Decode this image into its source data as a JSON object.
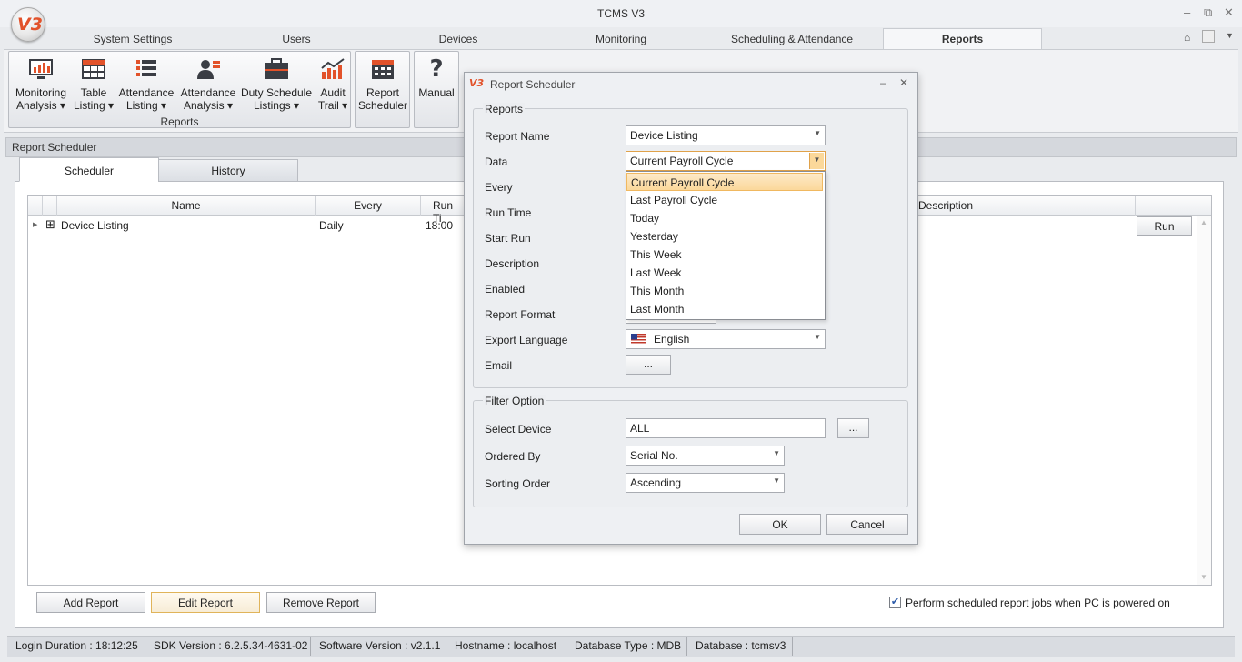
{
  "app": {
    "title": "TCMS V3",
    "logo": "V3"
  },
  "window_controls": [
    "minimize-icon",
    "restore-icon",
    "close-icon"
  ],
  "tabs": [
    {
      "label": "System Settings"
    },
    {
      "label": "Users"
    },
    {
      "label": "Devices"
    },
    {
      "label": "Monitoring"
    },
    {
      "label": "Scheduling & Attendance"
    },
    {
      "label": "Reports",
      "active": true
    }
  ],
  "ribbon": {
    "group_label": "Reports",
    "buttons": [
      {
        "line1": "Monitoring",
        "line2": "Analysis ▾",
        "icon": "monitor-chart-icon"
      },
      {
        "line1": "Table",
        "line2": "Listing ▾",
        "icon": "table-icon"
      },
      {
        "line1": "Attendance",
        "line2": "Listing ▾",
        "icon": "list-icon"
      },
      {
        "line1": "Attendance",
        "line2": "Analysis ▾",
        "icon": "user-chart-icon"
      },
      {
        "line1": "Duty Schedule",
        "line2": "Listings ▾",
        "icon": "briefcase-icon"
      },
      {
        "line1": "Audit",
        "line2": "Trail ▾",
        "icon": "audit-trail-icon"
      },
      {
        "line1": "Report",
        "line2": "Scheduler",
        "icon": "calendar-icon"
      },
      {
        "line1": "Manual",
        "line2": "",
        "icon": "question-icon"
      }
    ]
  },
  "panel": {
    "title": "Report Scheduler",
    "subtabs": [
      {
        "label": "Scheduler",
        "active": true
      },
      {
        "label": "History"
      }
    ],
    "grid": {
      "columns": [
        "Name",
        "Every",
        "Run Ti",
        "Description"
      ],
      "rows": [
        {
          "expander": "⊞",
          "name": "Device Listing",
          "every": "Daily",
          "run_time": "18:00",
          "action": "Run"
        }
      ]
    },
    "buttons": {
      "add": "Add Report",
      "edit": "Edit Report",
      "remove": "Remove Report"
    },
    "perform_checkbox": {
      "label": "Perform scheduled report jobs when PC is powered on",
      "checked": true
    }
  },
  "status_bar": [
    "Login Duration : 18:12:25",
    "SDK Version : 6.2.5.34-4631-02",
    "Software Version : v2.1.1",
    "Hostname : localhost",
    "Database Type : MDB",
    "Database : tcmsv3"
  ],
  "dialog": {
    "title": "Report Scheduler",
    "reports_legend": "Reports",
    "fields": {
      "report_name": {
        "label": "Report Name",
        "value": "Device Listing"
      },
      "data": {
        "label": "Data",
        "value": "Current Payroll Cycle"
      },
      "every": {
        "label": "Every"
      },
      "run_time": {
        "label": "Run Time"
      },
      "start_run": {
        "label": "Start Run"
      },
      "description": {
        "label": "Description"
      },
      "enabled": {
        "label": "Enabled"
      },
      "report_format": {
        "label": "Report Format"
      },
      "export_language": {
        "label": "Export Language",
        "value": "English"
      },
      "email": {
        "label": "Email",
        "button": "..."
      }
    },
    "data_options": [
      "Current Payroll Cycle",
      "Last Payroll Cycle",
      "Today",
      "Yesterday",
      "This Week",
      "Last Week",
      "This Month",
      "Last Month"
    ],
    "filter_legend": "Filter Option",
    "filter": {
      "select_device": {
        "label": "Select Device",
        "value": "ALL",
        "button": "..."
      },
      "ordered_by": {
        "label": "Ordered By",
        "value": "Serial No."
      },
      "sorting_order": {
        "label": "Sorting Order",
        "value": "Ascending"
      }
    },
    "ok": "OK",
    "cancel": "Cancel"
  }
}
